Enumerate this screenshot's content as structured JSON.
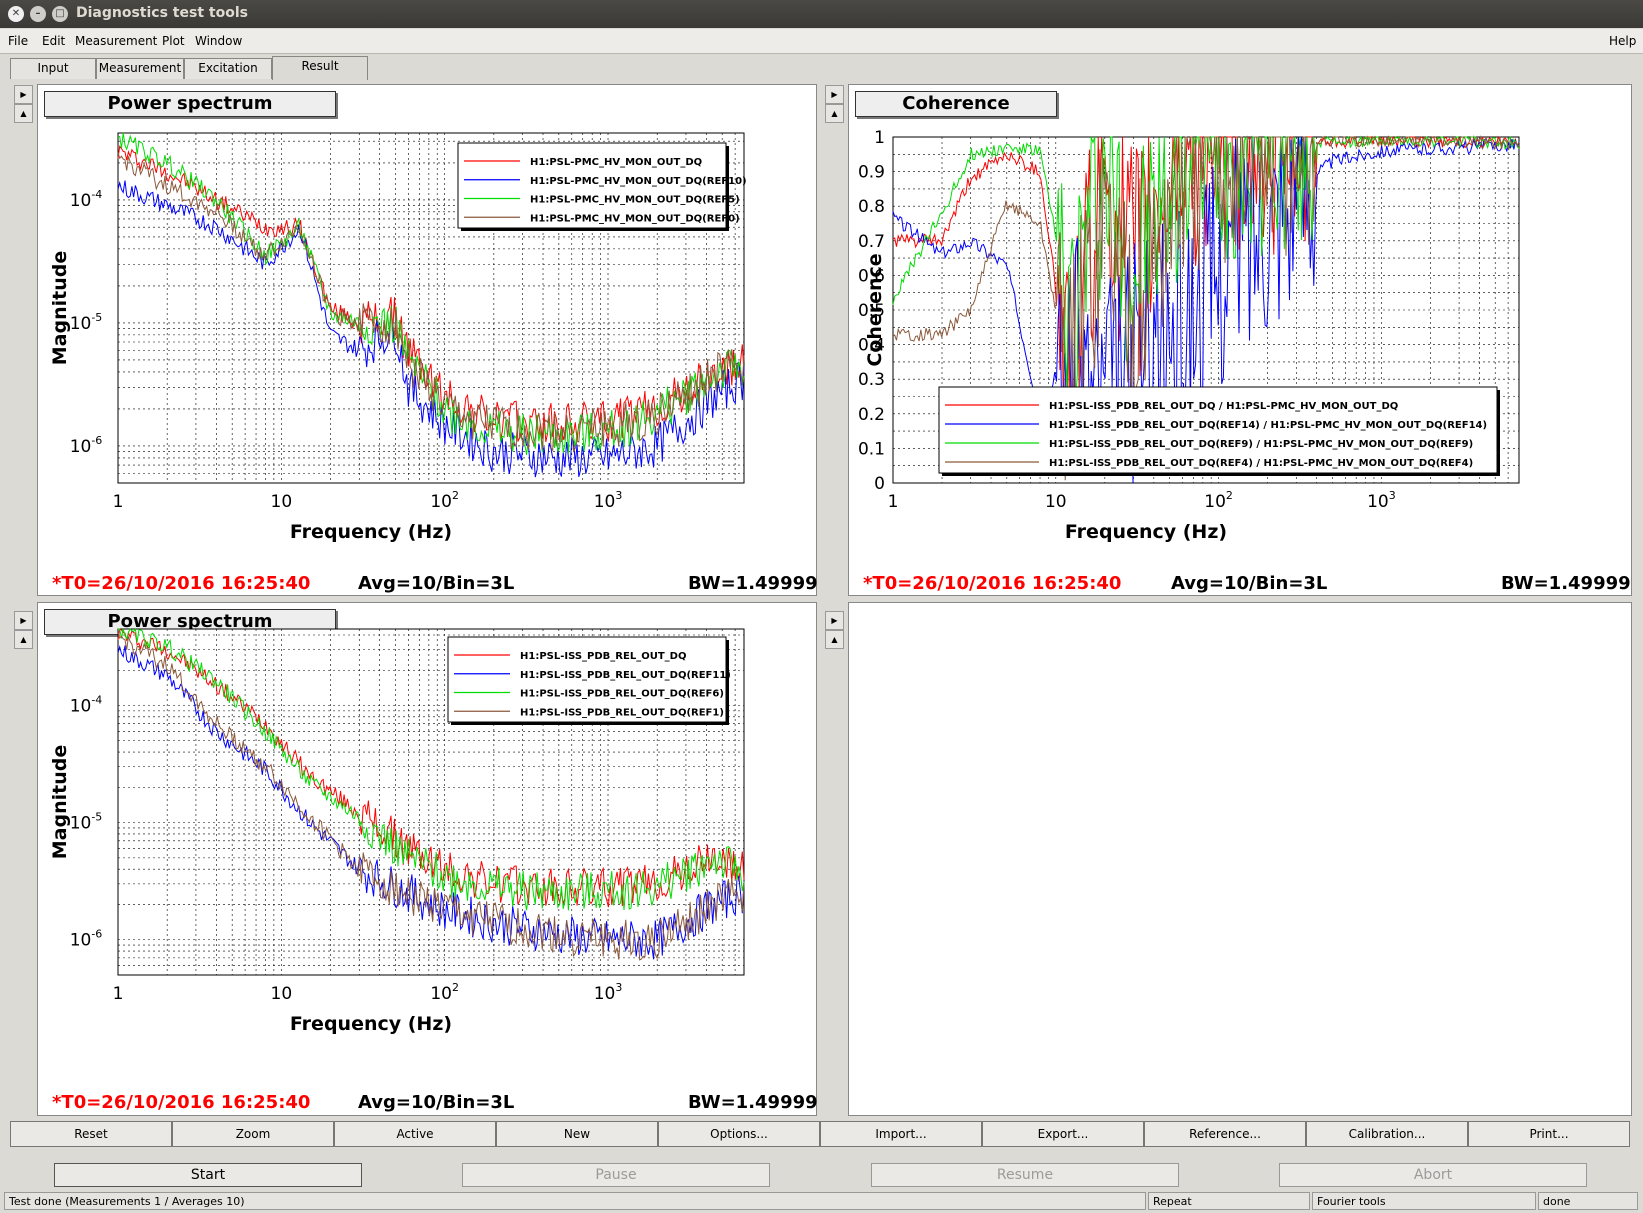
{
  "window": {
    "title": "Diagnostics test tools"
  },
  "menu": {
    "file": "File",
    "edit": "Edit",
    "measurement": "Measurement",
    "plot": "Plot",
    "window": "Window",
    "help": "Help"
  },
  "tabs": [
    "Input",
    "Measurement",
    "Excitation",
    "Result"
  ],
  "panels": {
    "p1": {
      "title": "Power spectrum",
      "xlabel": "Frequency (Hz)",
      "ylabel": "Magnitude",
      "t0": "*T0=26/10/2016 16:25:40",
      "avg": "Avg=10/Bin=3L",
      "bw": "BW=1.49999",
      "legend": [
        "H1:PSL-PMC_HV_MON_OUT_DQ",
        "H1:PSL-PMC_HV_MON_OUT_DQ(REF10)",
        "H1:PSL-PMC_HV_MON_OUT_DQ(REF5)",
        "H1:PSL-PMC_HV_MON_OUT_DQ(REF0)"
      ],
      "xticks": [
        "1",
        "10",
        "10",
        "10"
      ],
      "xexp": [
        "",
        "",
        "2",
        "3"
      ],
      "yticks": [
        "10",
        "10",
        "10"
      ],
      "yexp": [
        "-4",
        "-5",
        "-6"
      ]
    },
    "p2": {
      "title": "Coherence",
      "xlabel": "Frequency (Hz)",
      "ylabel": "Coherence",
      "t0": "*T0=26/10/2016 16:25:40",
      "avg": "Avg=10/Bin=3L",
      "bw": "BW=1.49999",
      "legend": [
        "H1:PSL-ISS_PDB_REL_OUT_DQ / H1:PSL-PMC_HV_MON_OUT_DQ",
        "H1:PSL-ISS_PDB_REL_OUT_DQ(REF14) / H1:PSL-PMC_HV_MON_OUT_DQ(REF14)",
        "H1:PSL-ISS_PDB_REL_OUT_DQ(REF9) / H1:PSL-PMC_HV_MON_OUT_DQ(REF9)",
        "H1:PSL-ISS_PDB_REL_OUT_DQ(REF4) / H1:PSL-PMC_HV_MON_OUT_DQ(REF4)"
      ],
      "xticks": [
        "1",
        "10",
        "10",
        "10"
      ],
      "xexp": [
        "",
        "",
        "2",
        "3"
      ],
      "yticks": [
        "1",
        "0.9",
        "0.8",
        "0.7",
        "0.6",
        "0.5",
        "0.4",
        "0.3",
        "0.2",
        "0.1",
        "0"
      ]
    },
    "p3": {
      "title": "Power spectrum",
      "xlabel": "Frequency (Hz)",
      "ylabel": "Magnitude",
      "t0": "*T0=26/10/2016 16:25:40",
      "avg": "Avg=10/Bin=3L",
      "bw": "BW=1.49999",
      "legend": [
        "H1:PSL-ISS_PDB_REL_OUT_DQ",
        "H1:PSL-ISS_PDB_REL_OUT_DQ(REF11)",
        "H1:PSL-ISS_PDB_REL_OUT_DQ(REF6)",
        "H1:PSL-ISS_PDB_REL_OUT_DQ(REF1)"
      ],
      "xticks": [
        "1",
        "10",
        "10",
        "10"
      ],
      "xexp": [
        "",
        "",
        "2",
        "3"
      ],
      "yticks": [
        "10",
        "10",
        "10"
      ],
      "yexp": [
        "-4",
        "-5",
        "-6"
      ]
    }
  },
  "series_colors": [
    "#ff0000",
    "#0000ff",
    "#00dd00",
    "#8b5a3c"
  ],
  "toolbar": [
    "Reset",
    "Zoom",
    "Active",
    "New",
    "Options...",
    "Import...",
    "Export...",
    "Reference...",
    "Calibration...",
    "Print..."
  ],
  "controls": {
    "start": "Start",
    "pause": "Pause",
    "resume": "Resume",
    "abort": "Abort"
  },
  "statusbar": {
    "message": "Test done (Measurements 1 / Averages 10)",
    "repeat": "Repeat",
    "tools": "Fourier tools",
    "state": "done"
  },
  "chart_data": [
    {
      "type": "line",
      "title": "Power spectrum",
      "xlabel": "Frequency (Hz)",
      "ylabel": "Magnitude",
      "xscale": "log",
      "yscale": "log",
      "xlim": [
        1,
        6800
      ],
      "ylim": [
        5e-07,
        0.00035
      ],
      "grid": true,
      "legend_position": "top-right",
      "x": [
        1,
        2,
        4,
        8,
        13,
        20,
        30,
        50,
        60,
        100,
        200,
        500,
        1000,
        2000,
        4500,
        6500
      ],
      "series": [
        {
          "name": "H1:PSL-PMC_HV_MON_OUT_DQ",
          "values": [
            0.00025,
            0.00017,
            0.0001,
            6e-05,
            6e-05,
            1.3e-05,
            1e-05,
            1.1e-05,
            6e-06,
            2.5e-06,
            1.6e-06,
            1.5e-06,
            1.6e-06,
            2e-06,
            3.8e-06,
            4.5e-06
          ]
        },
        {
          "name": "H1:PSL-PMC_HV_MON_OUT_DQ(REF10)",
          "values": [
            0.00013,
            9e-05,
            6e-05,
            3e-05,
            6e-05,
            8e-06,
            6e-06,
            9e-06,
            3e-06,
            1.5e-06,
            9e-07,
            8e-07,
            8e-07,
            1e-06,
            2.5e-06,
            3.5e-06
          ]
        },
        {
          "name": "H1:PSL-PMC_HV_MON_OUT_DQ(REF5)",
          "values": [
            0.00032,
            0.0002,
            0.0001,
            3.5e-05,
            6e-05,
            1.2e-05,
            1e-05,
            1e-05,
            5e-06,
            2e-06,
            1.3e-06,
            1.2e-06,
            1.3e-06,
            1.8e-06,
            3.8e-06,
            4.5e-06
          ]
        },
        {
          "name": "H1:PSL-PMC_HV_MON_OUT_DQ(REF0)",
          "values": [
            0.00022,
            0.00013,
            8e-05,
            3.5e-05,
            6e-05,
            1.2e-05,
            1e-05,
            1e-05,
            5e-06,
            2e-06,
            1.4e-06,
            1.3e-06,
            1.4e-06,
            1.8e-06,
            3.8e-06,
            4.5e-06
          ]
        }
      ]
    },
    {
      "type": "line",
      "title": "Coherence",
      "xlabel": "Frequency (Hz)",
      "ylabel": "Coherence",
      "xscale": "log",
      "xlim": [
        1,
        7000
      ],
      "ylim": [
        0,
        1
      ],
      "grid": true,
      "legend_position": "bottom-right",
      "x": [
        1,
        2,
        3,
        5,
        8,
        12,
        20,
        30,
        60,
        100,
        200,
        500,
        1000,
        3000,
        7000
      ],
      "series": [
        {
          "name": "H1:PSL-ISS_PDB_REL_OUT_DQ / H1:PSL-PMC_HV_MON_OUT_DQ",
          "values": [
            0.7,
            0.7,
            0.88,
            0.95,
            0.9,
            0.3,
            0.9,
            0.6,
            0.95,
            0.98,
            0.99,
            0.99,
            0.99,
            0.99,
            0.98
          ]
        },
        {
          "name": "H1:PSL-ISS_PDB_REL_OUT_DQ(REF14) / H1:PSL-PMC_HV_MON_OUT_DQ(REF14)",
          "values": [
            0.77,
            0.66,
            0.7,
            0.63,
            0.2,
            0.4,
            0.25,
            0.35,
            0.45,
            0.6,
            0.8,
            0.93,
            0.96,
            0.97,
            0.98
          ]
        },
        {
          "name": "H1:PSL-ISS_PDB_REL_OUT_DQ(REF9) / H1:PSL-PMC_HV_MON_OUT_DQ(REF9)",
          "values": [
            0.53,
            0.78,
            0.95,
            0.97,
            0.96,
            0.5,
            0.9,
            0.6,
            0.95,
            0.98,
            0.99,
            0.99,
            0.99,
            0.99,
            0.98
          ]
        },
        {
          "name": "H1:PSL-ISS_PDB_REL_OUT_DQ(REF4) / H1:PSL-PMC_HV_MON_OUT_DQ(REF4)",
          "values": [
            0.43,
            0.43,
            0.5,
            0.81,
            0.75,
            0.3,
            0.8,
            0.5,
            0.9,
            0.97,
            0.99,
            0.99,
            0.99,
            0.99,
            0.98
          ]
        }
      ]
    },
    {
      "type": "line",
      "title": "Power spectrum",
      "xlabel": "Frequency (Hz)",
      "ylabel": "Magnitude",
      "xscale": "log",
      "yscale": "log",
      "xlim": [
        1,
        6800
      ],
      "ylim": [
        5e-07,
        0.00045
      ],
      "grid": true,
      "legend_position": "top-right",
      "x": [
        1,
        2,
        4,
        8,
        15,
        30,
        60,
        100,
        200,
        500,
        1000,
        2000,
        4500,
        6500
      ],
      "series": [
        {
          "name": "H1:PSL-ISS_PDB_REL_OUT_DQ",
          "values": [
            0.00042,
            0.0003,
            0.00015,
            7e-05,
            2.5e-05,
            1.2e-05,
            6e-06,
            4e-06,
            3e-06,
            2.7e-06,
            2.8e-06,
            3e-06,
            5e-06,
            3.8e-06
          ]
        },
        {
          "name": "H1:PSL-ISS_PDB_REL_OUT_DQ(REF11)",
          "values": [
            0.0003,
            0.00018,
            6e-05,
            2.8e-05,
            1e-05,
            4e-06,
            2.5e-06,
            1.8e-06,
            1.4e-06,
            1.1e-06,
            1e-06,
            1e-06,
            2e-06,
            2.5e-06
          ]
        },
        {
          "name": "H1:PSL-ISS_PDB_REL_OUT_DQ(REF6)",
          "values": [
            0.00045,
            0.00032,
            0.00016,
            6e-05,
            2.2e-05,
            1.1e-05,
            5e-06,
            3.5e-06,
            2.8e-06,
            2.5e-06,
            2.6e-06,
            2.8e-06,
            5e-06,
            3.8e-06
          ]
        },
        {
          "name": "H1:PSL-ISS_PDB_REL_OUT_DQ(REF1)",
          "values": [
            0.00038,
            0.00022,
            7e-05,
            3e-05,
            1.1e-05,
            4e-06,
            2.5e-06,
            1.8e-06,
            1.4e-06,
            1.1e-06,
            1e-06,
            1e-06,
            2e-06,
            2.5e-06
          ]
        }
      ]
    }
  ]
}
